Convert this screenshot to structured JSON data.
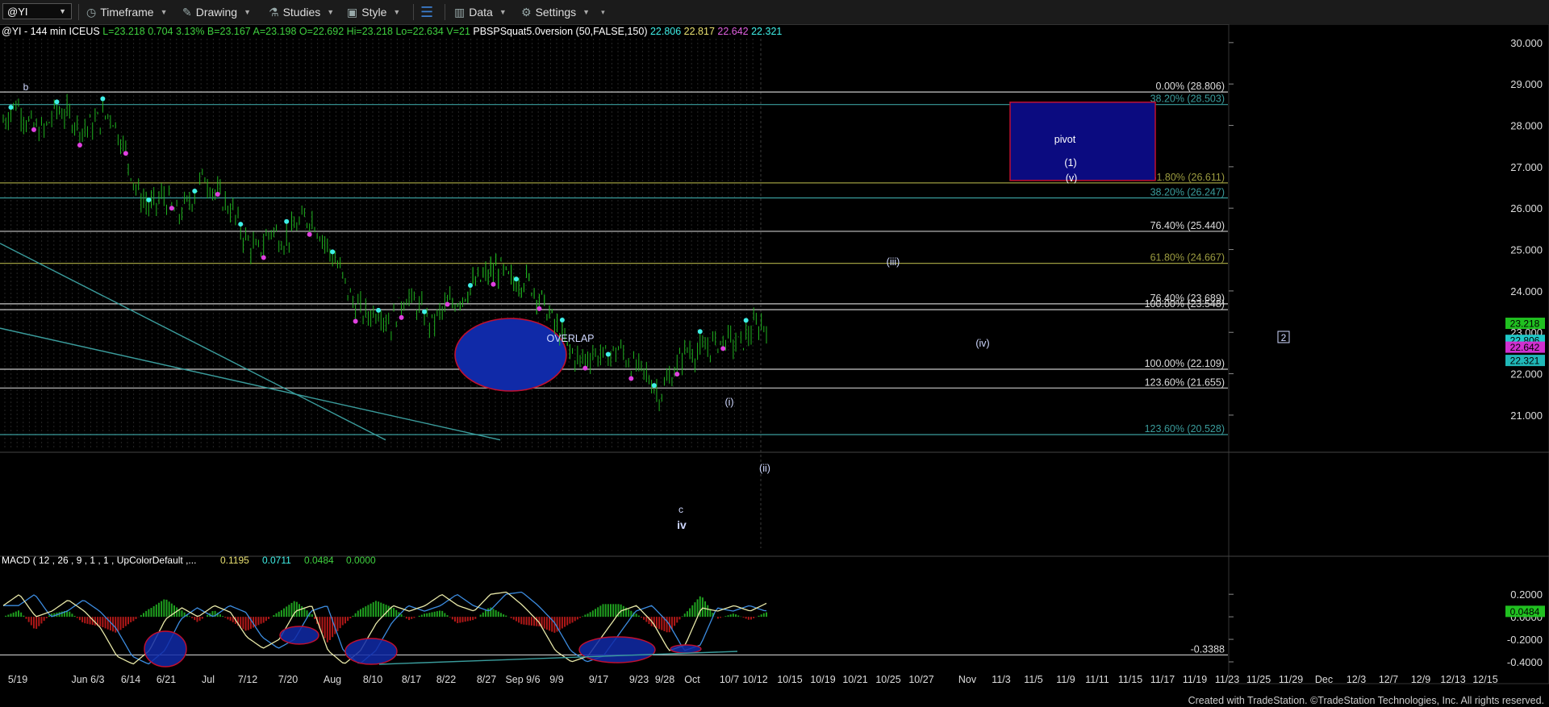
{
  "toolbar": {
    "symbol": "@YI",
    "timeframe": "Timeframe",
    "drawing": "Drawing",
    "studies": "Studies",
    "style": "Style",
    "data": "Data",
    "settings": "Settings"
  },
  "footer": "Created with TradeStation. ©TradeStation Technologies, Inc. All rights reserved.",
  "colors": {
    "background": "#000000",
    "bars": "#1fb31f",
    "cyan_dot": "#3ff0e8",
    "magenta_dot": "#e040e0",
    "ellipse_fill": "#102aa8",
    "ellipse_border": "#c01030",
    "pivot_fill": "#0b0b80",
    "fib_white": "#c8c8c8",
    "fib_olive": "#9c9c40",
    "fib_teal": "#3a9c9c",
    "macd_line": "#e8e8a8",
    "signal_line": "#3c8ce0",
    "hist_up": "#1f9f1f",
    "hist_down": "#b01818"
  },
  "chart_data": [
    {
      "type": "candlestick",
      "header": {
        "title": "@YI - 144 min  ICEUS",
        "last": "L=23.218",
        "change": "0.704",
        "change_pct": "3.13%",
        "bid": "B=23.167",
        "ask": "A=23.198",
        "open": "O=22.692",
        "high": "Hi=23.218",
        "low": "Lo=22.634",
        "volume": "V=21",
        "study": "PBSPSquat5.0version (50,FALSE,150)",
        "study_values": [
          "22.806",
          "22.817",
          "22.642",
          "22.321"
        ]
      },
      "ylim": [
        20.2,
        30.25
      ],
      "y_ticks": [
        "30.000",
        "29.000",
        "28.000",
        "27.000",
        "26.000",
        "25.000",
        "24.000",
        "23.000",
        "22.000",
        "21.000"
      ],
      "x_ticks": [
        "5/19",
        "Jun 6/3",
        "6/14",
        "6/21",
        "Jul",
        "7/12",
        "7/20",
        "Aug",
        "8/10",
        "8/17",
        "8/22",
        "8/27",
        "Sep 9/6",
        "9/9",
        "9/17",
        "9/23",
        "9/28",
        "Oct",
        "10/7",
        "10/12",
        "10/15",
        "10/19",
        "10/21",
        "10/25",
        "10/27",
        "Nov",
        "11/3",
        "11/5",
        "11/9",
        "11/11",
        "11/15",
        "11/17",
        "11/19",
        "11/23",
        "11/25",
        "11/29",
        "Dec",
        "12/3",
        "12/7",
        "12/9",
        "12/13",
        "12/15"
      ],
      "fib_levels": [
        {
          "label": "0.00%",
          "value": "(28.806)",
          "price": 28.806,
          "color": "white"
        },
        {
          "label": "38.20%",
          "value": "(28.503)",
          "price": 28.503,
          "color": "teal"
        },
        {
          "label": "61.80%",
          "value": "(26.611)",
          "price": 26.611,
          "color": "olive"
        },
        {
          "label": "38.20%",
          "value": "(26.247)",
          "price": 26.247,
          "color": "teal"
        },
        {
          "label": "76.40%",
          "value": "(25.440)",
          "price": 25.44,
          "color": "white"
        },
        {
          "label": "61.80%",
          "value": "(24.667)",
          "price": 24.667,
          "color": "olive"
        },
        {
          "label": "76.40%",
          "value": "(23.689)",
          "price": 23.689,
          "color": "white"
        },
        {
          "label": "100.00%",
          "value": "(23.548)",
          "price": 23.548,
          "color": "white"
        },
        {
          "label": "100.00%",
          "value": "(22.109)",
          "price": 22.109,
          "color": "white"
        },
        {
          "label": "123.60%",
          "value": "(21.655)",
          "price": 21.655,
          "color": "white"
        },
        {
          "label": "123.60%",
          "value": "(20.528)",
          "price": 20.528,
          "color": "teal"
        }
      ],
      "price_tags": [
        {
          "value": "23.218",
          "price": 23.218,
          "color": "#20c020"
        },
        {
          "value": "22.806",
          "price": 22.806,
          "color": "#20c8c8"
        },
        {
          "value": "22.642",
          "price": 22.642,
          "color": "#d030d0"
        },
        {
          "value": "22.321",
          "price": 22.321,
          "color": "#20b8b8"
        }
      ],
      "annotations": [
        {
          "text": "b",
          "kind": "wave"
        },
        {
          "text": "OVERLAP",
          "kind": "note"
        },
        {
          "text": "(i)",
          "kind": "wave"
        },
        {
          "text": "(ii)",
          "kind": "wave"
        },
        {
          "text": "(iii)",
          "kind": "wave"
        },
        {
          "text": "(iv)",
          "kind": "wave"
        },
        {
          "text": "c",
          "kind": "wave"
        },
        {
          "text": "iv",
          "kind": "wave-bold"
        },
        {
          "text": "2",
          "kind": "boxed"
        }
      ],
      "pivot_box": {
        "text": "pivot",
        "line1": "(1)",
        "line2": "(v)",
        "price_low": 26.67,
        "price_high": 28.56
      },
      "price_path": [
        28.1,
        28.55,
        28.0,
        27.85,
        28.4,
        28.2,
        27.9,
        28.1,
        28.3,
        27.5,
        26.4,
        26.0,
        26.3,
        25.8,
        26.2,
        26.8,
        26.3,
        26.0,
        25.3,
        24.9,
        25.5,
        25.2,
        25.6,
        25.8,
        25.2,
        24.6,
        23.8,
        23.4,
        23.55,
        23.2,
        23.9,
        23.6,
        23.2,
        23.6,
        23.8,
        24.1,
        24.35,
        24.55,
        24.2,
        24.3,
        23.9,
        23.3,
        22.7,
        22.3,
        22.5,
        22.4,
        22.6,
        22.2,
        22.0,
        21.5,
        22.0,
        22.6,
        22.5,
        22.7,
        22.85,
        22.7,
        23.1,
        23.218
      ]
    },
    {
      "type": "macd",
      "label": "MACD ( 12 , 26 , 9 , 1 , 1 , UpColorDefault ,...",
      "values": [
        "0.1195",
        "0.0711",
        "0.0484",
        "0.0000"
      ],
      "ylim": [
        -0.45,
        0.28
      ],
      "y_ticks": [
        "0.2000",
        "0.0000",
        "-0.2000",
        "-0.4000"
      ],
      "tags": [
        {
          "value": "0.0484",
          "level": 0.0484
        }
      ],
      "level_line": {
        "value": "-0.3388",
        "level": -0.3388
      },
      "macd_path": [
        0.1,
        0.2,
        0.0,
        0.05,
        0.15,
        0.05,
        -0.1,
        -0.35,
        -0.42,
        -0.3,
        -0.02,
        0.08,
        0.0,
        0.1,
        0.04,
        -0.18,
        -0.28,
        -0.2,
        0.05,
        0.1,
        -0.3,
        -0.42,
        -0.3,
        -0.05,
        0.1,
        0.05,
        0.1,
        0.2,
        0.1,
        0.05,
        0.2,
        0.22,
        0.1,
        -0.05,
        -0.3,
        -0.4,
        -0.35,
        -0.15,
        0.05,
        0.1,
        -0.05,
        -0.3,
        -0.25,
        0.08,
        0.05,
        0.1,
        0.05,
        0.12
      ]
    }
  ]
}
